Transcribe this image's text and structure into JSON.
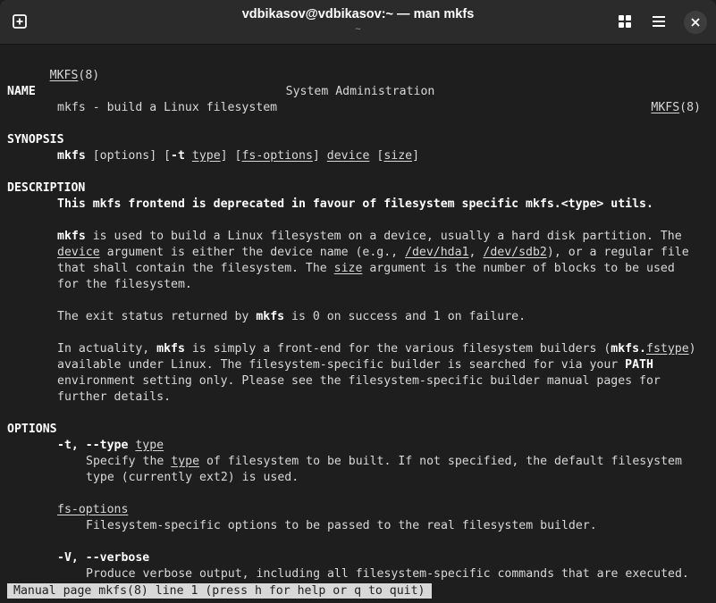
{
  "window": {
    "title": "vdbikasov@vdbikasov:~ — man mkfs",
    "subtitle": "~"
  },
  "header": {
    "left": "MKFS",
    "left_suffix": "(8)",
    "center": "System Administration",
    "right": "MKFS",
    "right_suffix": "(8)"
  },
  "name_section": {
    "heading": "NAME",
    "text": "mkfs - build a Linux filesystem"
  },
  "synopsis": {
    "heading": "SYNOPSIS",
    "cmd": "mkfs",
    "p1": " [options] [",
    "flag": "-t",
    "p2": " ",
    "type": "type",
    "p3": "] [",
    "fsopts": "fs-options",
    "p4": "] ",
    "device": "device",
    "p5": " [",
    "size": "size",
    "p6": "]"
  },
  "description": {
    "heading": "DESCRIPTION",
    "deprecated": "This mkfs frontend is deprecated in favour of filesystem specific mkfs.<type> utils.",
    "para1": {
      "l1_cmd": "mkfs",
      "l1_text": " is used to build a Linux filesystem on a device, usually a hard disk partition. The",
      "l2_device": "device",
      "l2_t1": " argument is either the device name (e.g., ",
      "l2_hda1": "/dev/hda1",
      "l2_t2": ", ",
      "l2_sdb2": "/dev/sdb2",
      "l2_t3": "), or a regular file",
      "l3_t1": "that shall contain the filesystem. The ",
      "l3_size": "size",
      "l3_t2": " argument is the number of blocks to be used",
      "l4": "for the filesystem."
    },
    "para2": {
      "t1": "The exit status returned by ",
      "cmd": "mkfs",
      "t2": " is 0 on success and 1 on failure."
    },
    "para3": {
      "l1_t1": "In actuality, ",
      "l1_cmd": "mkfs",
      "l1_t2": " is simply a front-end for the various filesystem builders (",
      "l1_cmd2": "mkfs.",
      "l1_fstype": "fstype",
      "l1_t3": ")",
      "l2_t1": "available under Linux. The filesystem-specific builder is searched for via your ",
      "l2_path": "PATH",
      "l3": "environment setting only. Please see the filesystem-specific builder manual pages for",
      "l4": "further details."
    }
  },
  "options": {
    "heading": "OPTIONS",
    "opt1": {
      "flags": "-t, --type",
      "sp": " ",
      "arg": "type",
      "d1_t1": "Specify the ",
      "d1_type": "type",
      "d1_t2": " of filesystem to be built. If not specified, the default filesystem",
      "d2": "type (currently ext2) is used."
    },
    "opt2": {
      "name": "fs-options",
      "d1": "Filesystem-specific options to be passed to the real filesystem builder."
    },
    "opt3": {
      "flags": "-V, --verbose",
      "d1": "Produce verbose output, including all filesystem-specific commands that are executed."
    }
  },
  "statusbar": {
    "text": "Manual page mkfs(8) line 1 (press h for help or q to quit)"
  },
  "colors": {
    "background": "#1e1e1e",
    "headerbar": "#2b2b2b",
    "text": "#d8d8d8",
    "bold": "#ffffff"
  }
}
